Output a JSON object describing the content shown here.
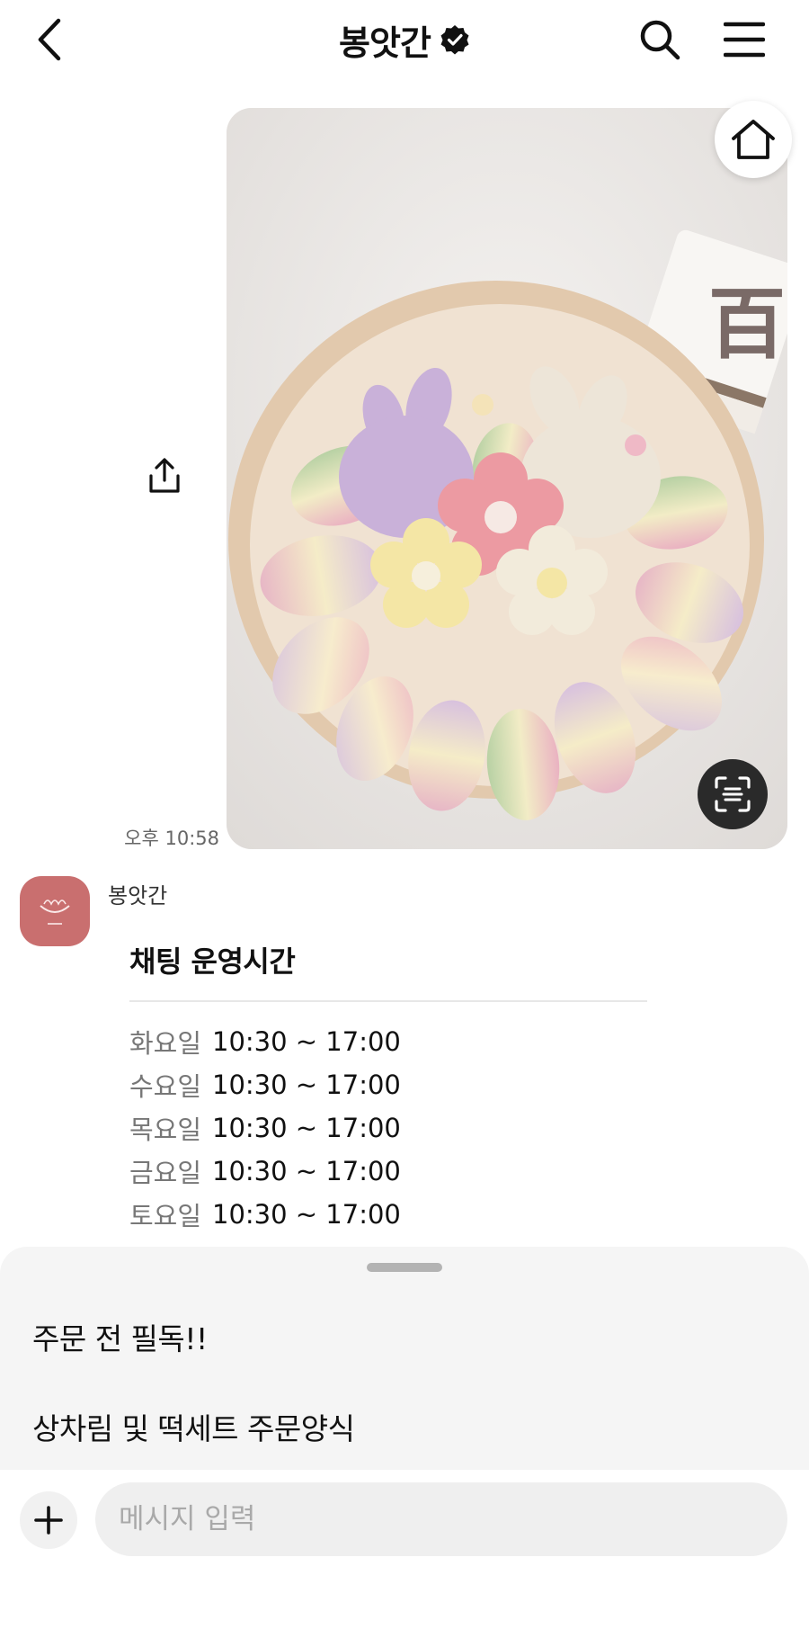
{
  "header": {
    "title": "봉앗간",
    "verified_icon": "verified-badge-icon",
    "back_icon": "chevron-left-icon",
    "search_icon": "search-icon",
    "menu_icon": "hamburger-menu-icon"
  },
  "image_message": {
    "time": "오후 10:58",
    "card_text": "百",
    "home_icon": "home-icon",
    "ocr_icon": "text-scan-icon",
    "share_icon": "share-icon"
  },
  "text_message": {
    "sender": "봉앗간",
    "title": "채팅 운영시간",
    "hours": [
      {
        "day": "화요일",
        "time": "10:30 ~ 17:00"
      },
      {
        "day": "수요일",
        "time": "10:30 ~ 17:00"
      },
      {
        "day": "목요일",
        "time": "10:30 ~ 17:00"
      },
      {
        "day": "금요일",
        "time": "10:30 ~ 17:00"
      },
      {
        "day": "토요일",
        "time": "10:30 ~ 17:00"
      }
    ]
  },
  "quick_replies": {
    "item1": "주문 전 필독!!",
    "item2": "상차림 및 떡세트 주문양식"
  },
  "composer": {
    "placeholder": "메시지 입력",
    "plus_icon": "plus-icon"
  },
  "colors": {
    "avatar_bg": "#c96f6f",
    "sheet_bg": "#f5f5f5",
    "input_bg": "#efefef"
  }
}
